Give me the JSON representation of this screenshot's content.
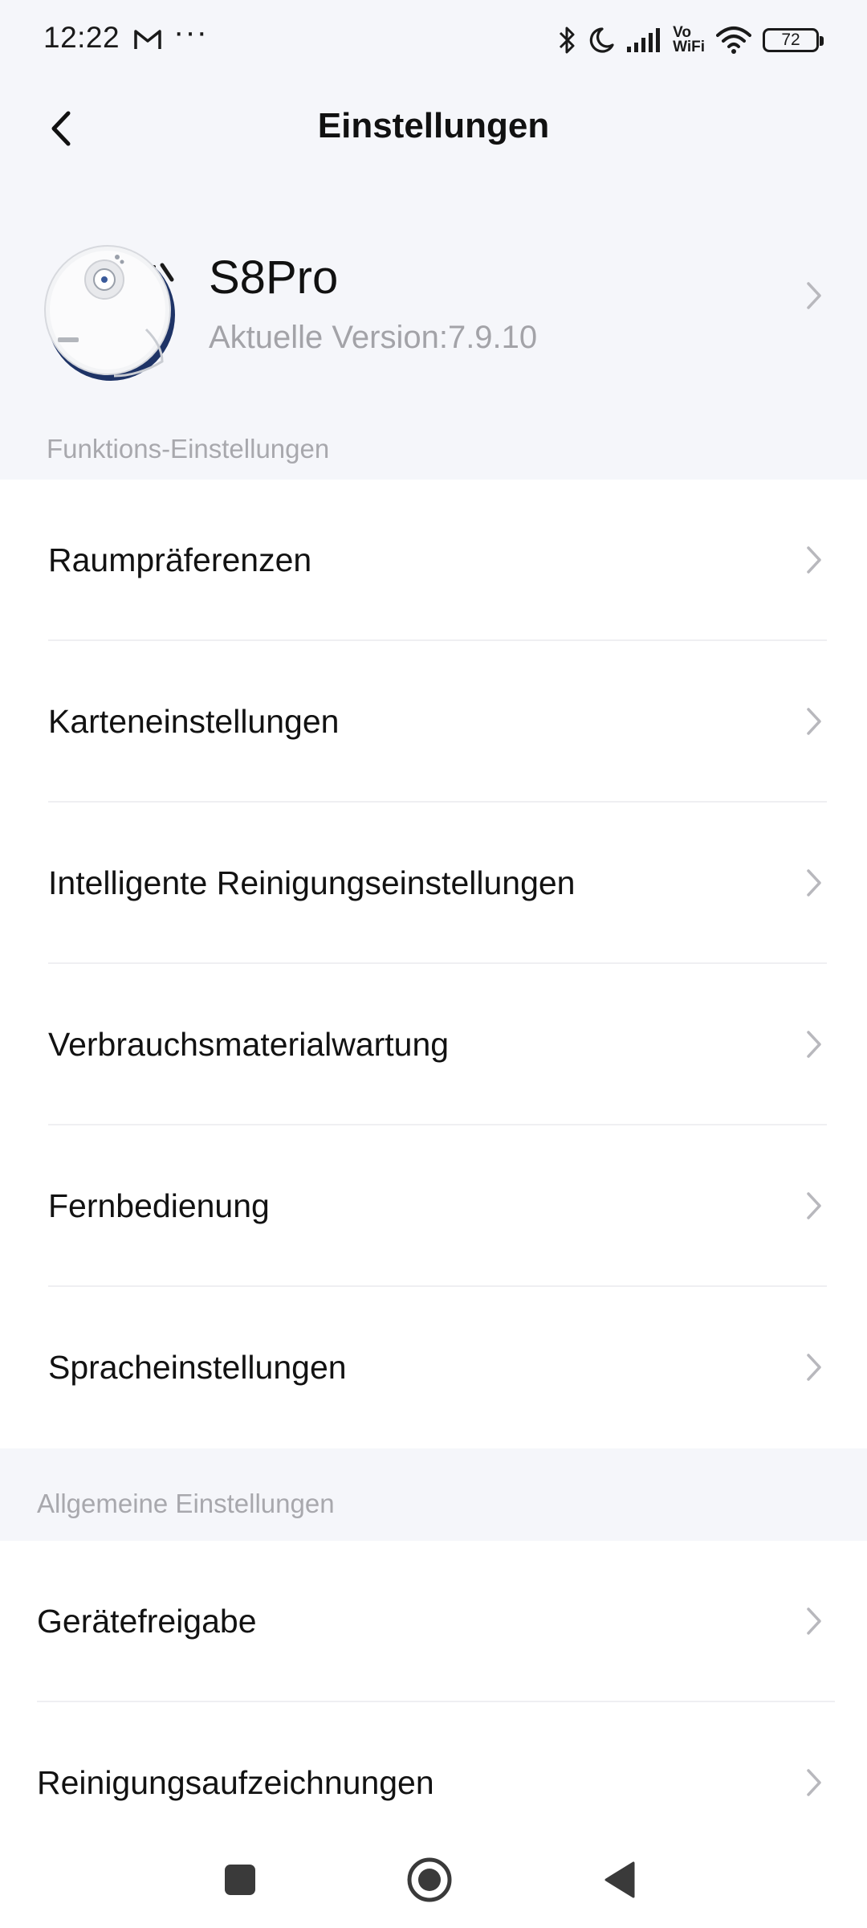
{
  "status_bar": {
    "time": "12:22",
    "gmail_icon": "gmail-icon",
    "overflow": "···",
    "vowifi_top": "Vo",
    "vowifi_bottom": "WiFi",
    "battery": "72"
  },
  "header": {
    "title": "Einstellungen",
    "back_icon": "back-arrow-icon"
  },
  "device": {
    "name": "S8Pro",
    "version": "Aktuelle Version:7.9.10",
    "image_icon": "robot-vacuum-image"
  },
  "function_settings": {
    "label": "Funktions-Einstellungen",
    "items": [
      {
        "label": "Raumpräferenzen"
      },
      {
        "label": "Karteneinstellungen"
      },
      {
        "label": "Intelligente Reinigungseinstellungen"
      },
      {
        "label": "Verbrauchsmaterialwartung"
      },
      {
        "label": "Fernbedienung"
      },
      {
        "label": "Spracheinstellungen"
      }
    ]
  },
  "general_settings": {
    "label": "Allgemeine Einstellungen",
    "items": [
      {
        "label": "Gerätefreigabe"
      },
      {
        "label": "Reinigungsaufzeichnungen"
      }
    ]
  },
  "navbar": {
    "icons": [
      "recents-square-icon",
      "home-circle-icon",
      "back-triangle-icon"
    ]
  },
  "colors": {
    "background": "#f5f6fa",
    "card": "#ffffff",
    "secondary_text": "#a3a3a8",
    "chevron": "#b8b8bd"
  }
}
